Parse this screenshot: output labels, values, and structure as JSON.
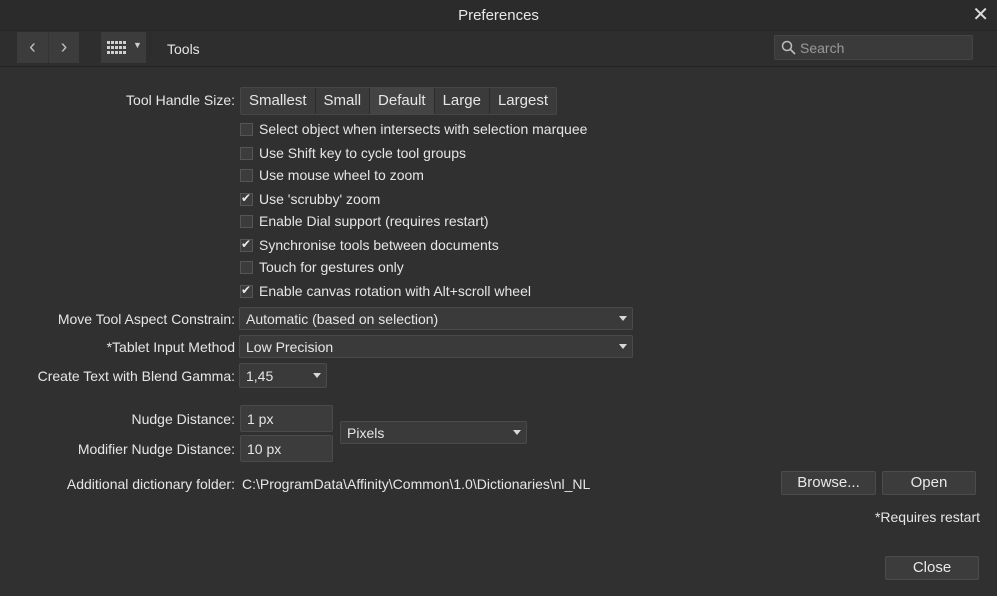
{
  "window": {
    "title": "Preferences",
    "close_glyph": "✕"
  },
  "toolbar": {
    "back_glyph": "‹",
    "forward_glyph": "›",
    "section_title": "Tools",
    "search_placeholder": "Search"
  },
  "tool_handle_size": {
    "label": "Tool Handle Size:",
    "options": [
      "Smallest",
      "Small",
      "Default",
      "Large",
      "Largest"
    ],
    "selected": "Default"
  },
  "checkboxes": [
    {
      "label": "Select object when intersects with selection marquee",
      "checked": false
    },
    {
      "label": "Use Shift key to cycle tool groups",
      "checked": false
    },
    {
      "label": "Use mouse wheel to zoom",
      "checked": false
    },
    {
      "label": "Use 'scrubby' zoom",
      "checked": true
    },
    {
      "label": "Enable Dial support (requires restart)",
      "checked": false
    },
    {
      "label": "Synchronise tools between documents",
      "checked": true
    },
    {
      "label": "Touch for gestures only",
      "checked": false
    },
    {
      "label": "Enable canvas rotation with Alt+scroll wheel",
      "checked": true
    }
  ],
  "move_tool": {
    "label": "Move Tool Aspect Constrain:",
    "value": "Automatic (based on selection)"
  },
  "tablet_input": {
    "label": "*Tablet Input Method",
    "value": "Low Precision"
  },
  "blend_gamma": {
    "label": "Create Text with Blend Gamma:",
    "value": "1,45"
  },
  "nudge": {
    "label": "Nudge Distance:",
    "value": "1 px"
  },
  "modifier_nudge": {
    "label": "Modifier Nudge Distance:",
    "value": "10 px"
  },
  "units": {
    "value": "Pixels"
  },
  "dictionary": {
    "label": "Additional dictionary folder:",
    "path": "C:\\ProgramData\\Affinity\\Common\\1.0\\Dictionaries\\nl_NL",
    "browse_label": "Browse...",
    "open_label": "Open"
  },
  "footer": {
    "restart_note": "*Requires restart",
    "close_label": "Close"
  },
  "colors": {
    "background": "#303030",
    "titlebar": "#2b2b2b",
    "control": "#3c3c3c",
    "text": "#e6e6e6"
  }
}
